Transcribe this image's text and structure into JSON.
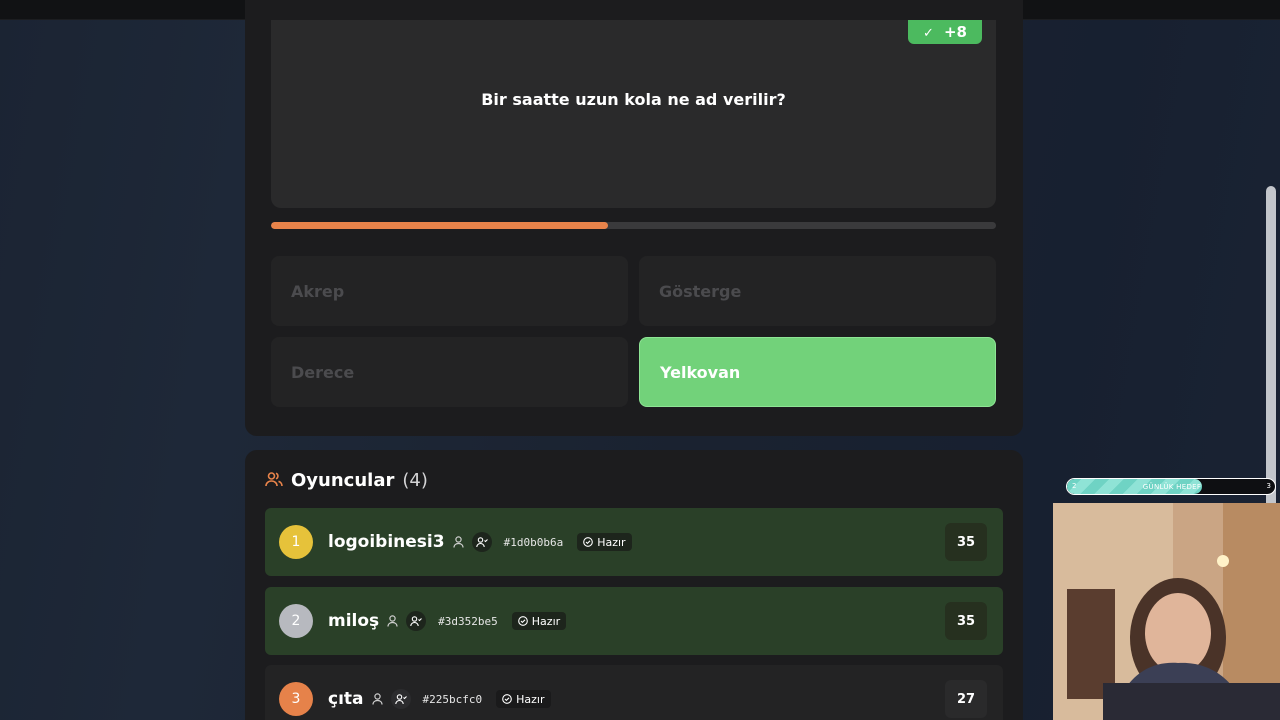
{
  "quiz": {
    "question": "Bir saatte uzun kola ne ad verilir?",
    "points_badge": "+8",
    "progress": 0.465,
    "answers": [
      {
        "label": "Akrep",
        "state": "inactive"
      },
      {
        "label": "Gösterge",
        "state": "inactive"
      },
      {
        "label": "Derece",
        "state": "inactive"
      },
      {
        "label": "Yelkovan",
        "state": "correct"
      }
    ]
  },
  "players": {
    "title": "Oyuncular",
    "count": "(4)",
    "list": [
      {
        "rank": "1",
        "name": "logoibinesi3",
        "id": "#1d0b0b6a",
        "status": "Hazır",
        "score": "35",
        "rank_color": "#e6c23a"
      },
      {
        "rank": "2",
        "name": "miloş",
        "id": "#3d352be5",
        "status": "Hazır",
        "score": "35",
        "rank_color": "#b7b9bf"
      },
      {
        "rank": "3",
        "name": "çıta",
        "id": "#225bcfc0",
        "status": "Hazır",
        "score": "27",
        "rank_color": "#e6824a"
      }
    ]
  },
  "stream_overlay": {
    "goal_label": "GÜNLÜK HEDEF",
    "goal_min": "2",
    "goal_max": "3",
    "goal_progress": 0.65
  },
  "colors": {
    "accent_orange": "#e8834a",
    "correct_green": "#72d27a",
    "row_green": "#2a4028"
  }
}
